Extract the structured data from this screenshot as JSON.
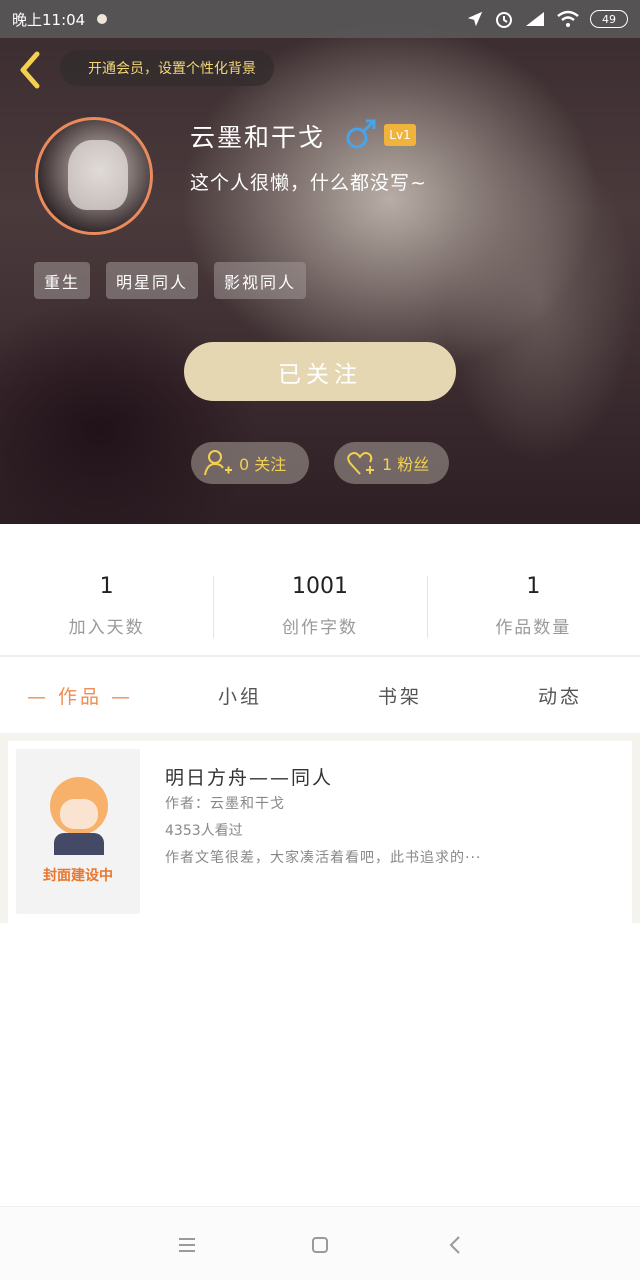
{
  "status_bar": {
    "time": "晚上11:04",
    "battery": "49"
  },
  "header": {
    "vip_prompt": "开通会员，设置个性化背景",
    "username": "云墨和干戈",
    "gender_symbol": "♂",
    "level": "Lv1",
    "bio": "这个人很懒，什么都没写~",
    "tags": [
      "重生",
      "明星同人",
      "影视同人"
    ],
    "follow_button": "已关注",
    "following_count": "0 关注",
    "fans_count": "1 粉丝"
  },
  "stats": [
    {
      "value": "1",
      "label": "加入天数"
    },
    {
      "value": "1001",
      "label": "创作字数"
    },
    {
      "value": "1",
      "label": "作品数量"
    }
  ],
  "tabs": [
    {
      "label": "— 作品 —",
      "active": true
    },
    {
      "label": "小组",
      "active": false
    },
    {
      "label": "书架",
      "active": false
    },
    {
      "label": "动态",
      "active": false
    }
  ],
  "books": [
    {
      "cover_text": "封面建设中",
      "title": "明日方舟——同人",
      "author": "作者：云墨和干戈",
      "views": "4353人看过",
      "description": "作者文笔很差，大家凑活着看吧，此书追求的···"
    }
  ],
  "colors": {
    "accent": "#ef8b52",
    "follow_button": "#e6d7b3",
    "pill_text": "#f3d04f",
    "level_badge": "#f2b33d"
  }
}
